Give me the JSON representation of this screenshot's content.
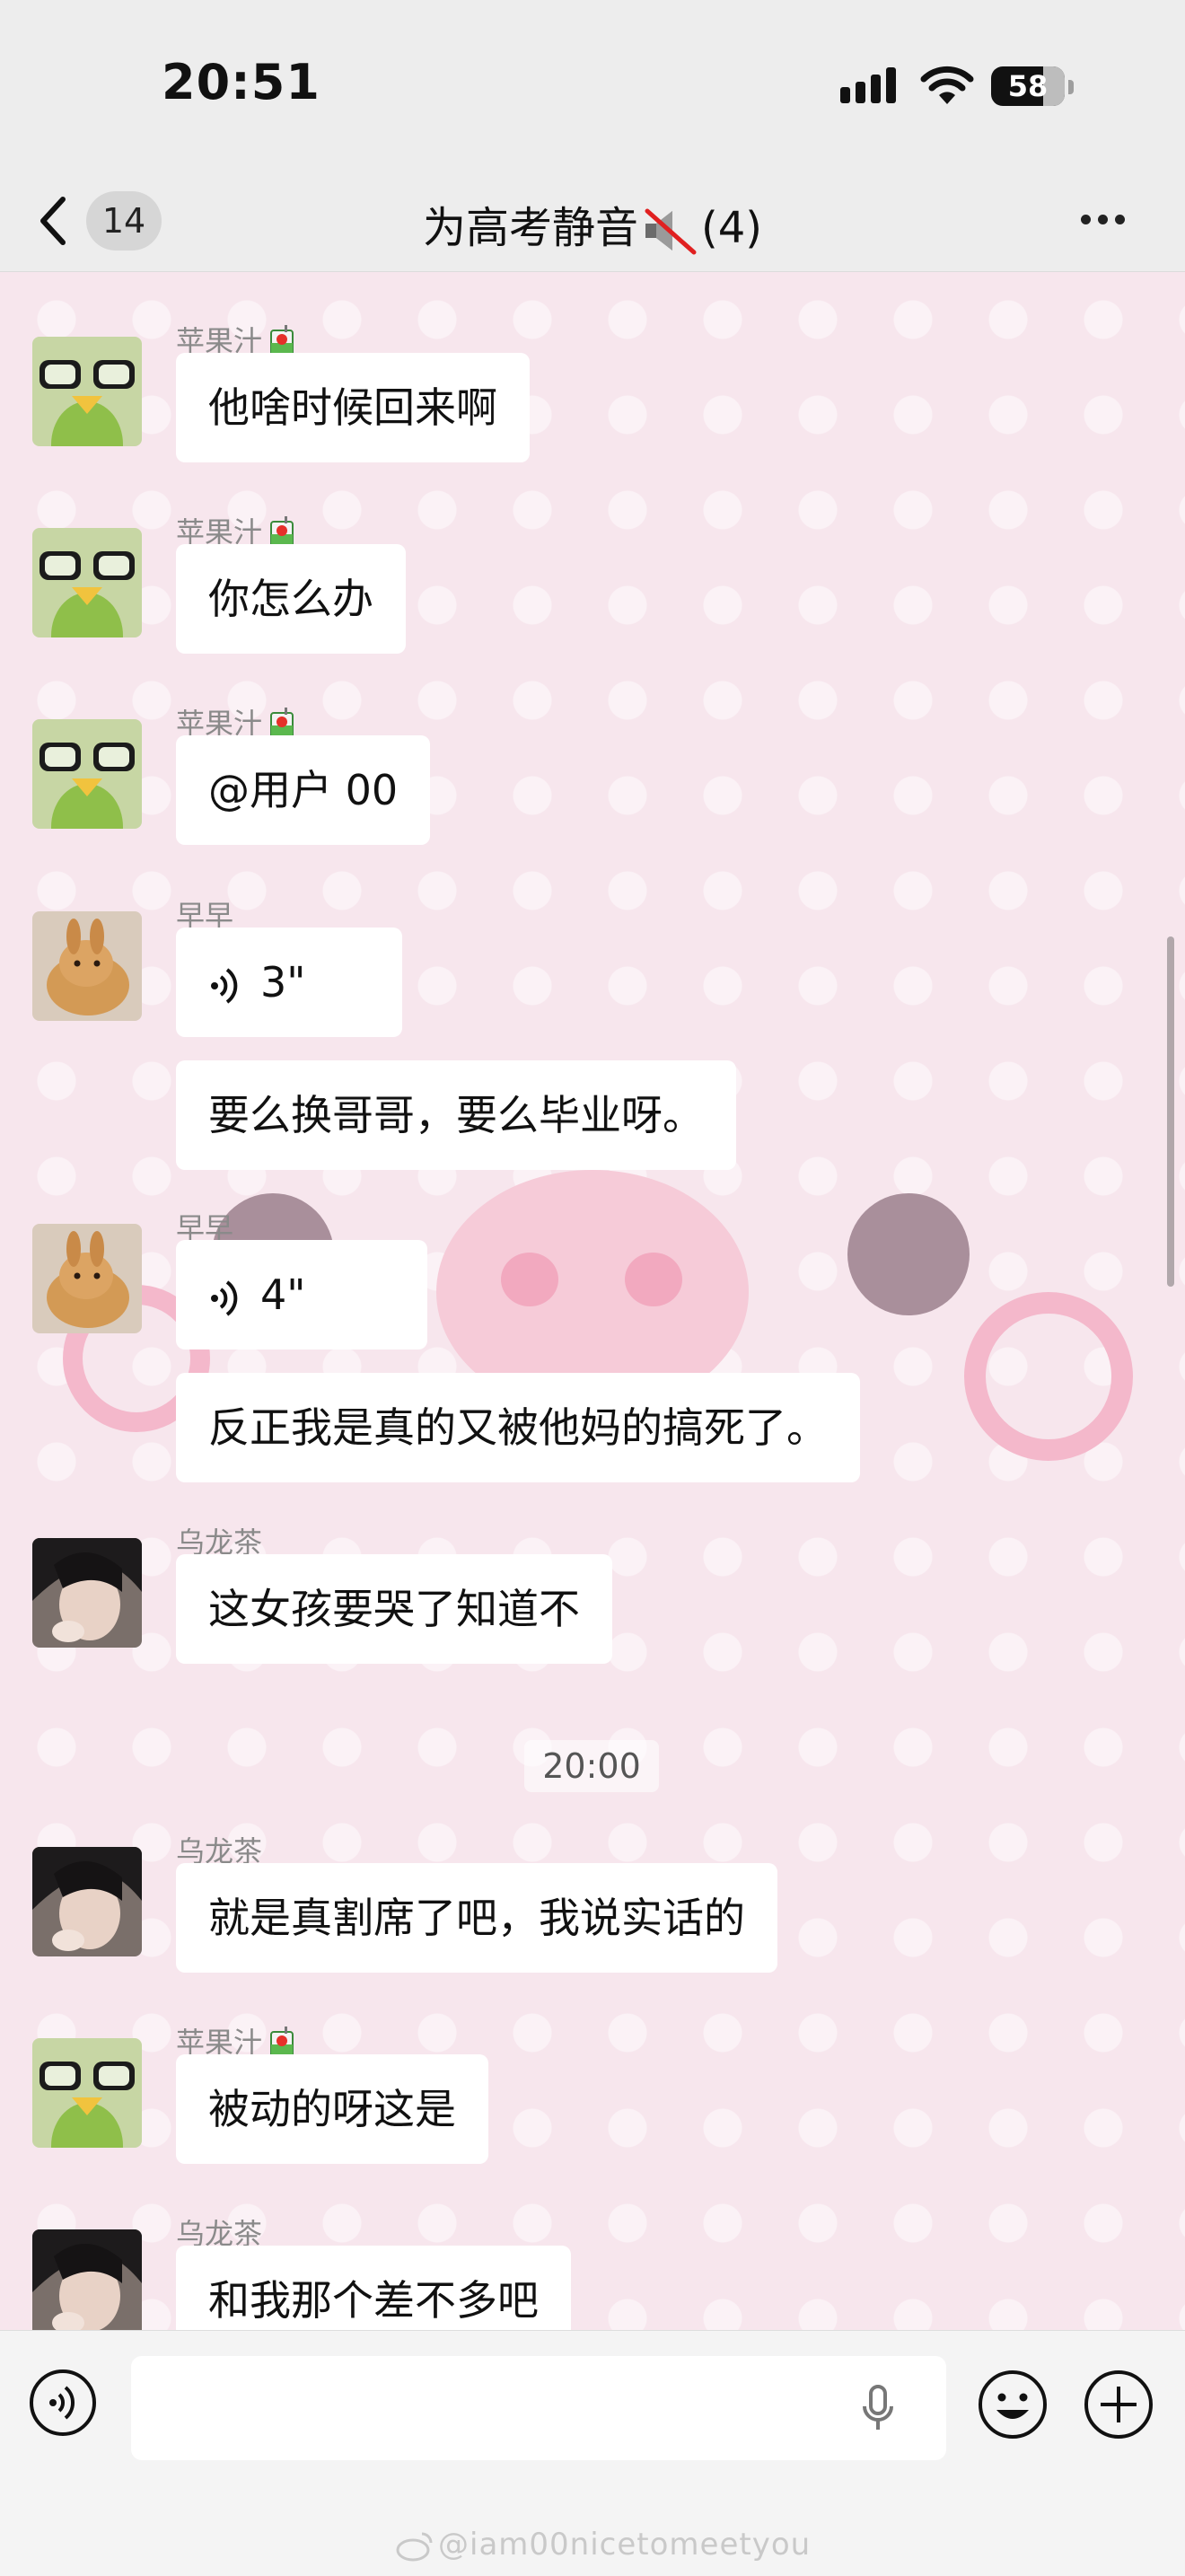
{
  "status_bar": {
    "time": "20:51",
    "battery": "58"
  },
  "nav": {
    "back_badge": "14",
    "title": "为高考静音",
    "member_count": "(4)"
  },
  "chat": {
    "time_divider": "20:00",
    "messages": [
      {
        "sender": "苹果汁",
        "text": "他啥时候回来啊"
      },
      {
        "sender": "苹果汁",
        "text": "你怎么办"
      },
      {
        "sender": "苹果汁",
        "text": "@用户 00"
      },
      {
        "sender": "早早",
        "voice": "3\"",
        "text": "要么换哥哥，要么毕业呀。"
      },
      {
        "sender": "早早",
        "voice": "4\"",
        "text": "反正我是真的又被他妈的搞死了。"
      },
      {
        "sender": "乌龙茶",
        "text": "这女孩要哭了知道不"
      },
      {
        "sender": "乌龙茶",
        "text": "就是真割席了吧，我说实话的"
      },
      {
        "sender": "苹果汁",
        "text": "被动的呀这是"
      },
      {
        "sender": "乌龙茶",
        "text": "和我那个差不多吧"
      }
    ]
  },
  "watermark": "@iam00nicetomeetyou",
  "colors": {
    "background": "#f7e6ed",
    "bubble": "#ffffff",
    "bar": "#ededed"
  }
}
